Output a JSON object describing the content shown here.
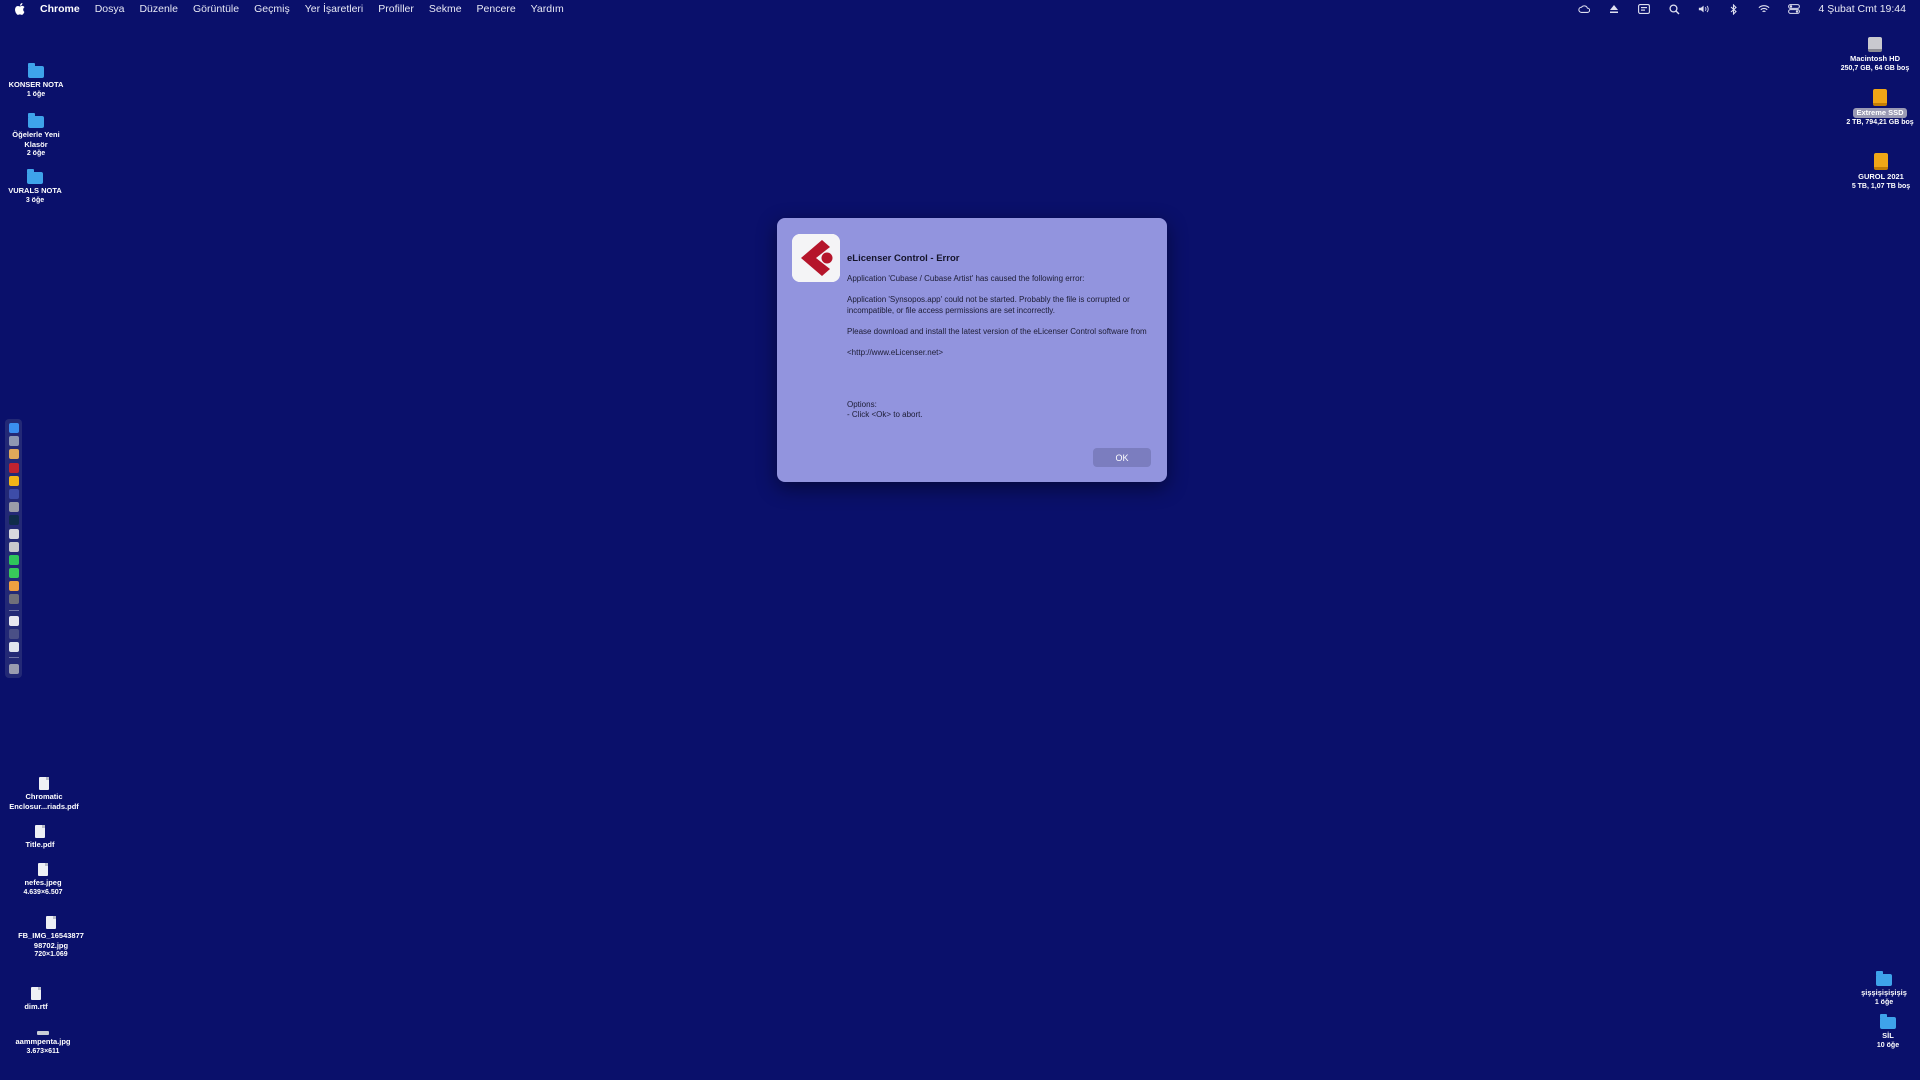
{
  "menubar": {
    "app_name": "Chrome",
    "items": [
      "Dosya",
      "Düzenle",
      "Görüntüle",
      "Geçmiş",
      "Yer İşaretleri",
      "Profiller",
      "Sekme",
      "Pencere",
      "Yardım"
    ],
    "clock": "4 Şubat Cmt  19:44",
    "status_icons": [
      "creative-cloud-icon",
      "eject-icon",
      "keyboard-input-icon",
      "search-icon",
      "volume-icon",
      "bluetooth-icon",
      "wifi-icon",
      "control-center-icon"
    ]
  },
  "desktop_left": [
    {
      "label": "KONSER NOTA",
      "sub": "1 öğe",
      "icon": "folder-icon"
    },
    {
      "label": "Öğelerle Yeni Klasör",
      "sub": "2 öğe",
      "icon": "folder-icon"
    },
    {
      "label": "VURALS NOTA",
      "sub": "3 öğe",
      "icon": "folder-icon"
    },
    {
      "label": "Chromatic Enclosur...riads.pdf",
      "sub": "",
      "icon": "document-icon"
    },
    {
      "label": "Title.pdf",
      "sub": "",
      "icon": "document-icon"
    },
    {
      "label": "nefes.jpeg",
      "sub": "4.639×6.507",
      "icon": "image-file-icon"
    },
    {
      "label": "FB_IMG_16543877 98702.jpg",
      "sub": "720×1.069",
      "icon": "image-file-icon"
    },
    {
      "label": "dim.rtf",
      "sub": "",
      "icon": "document-icon"
    },
    {
      "label": "aammpenta.jpg",
      "sub": "3.673×611",
      "icon": "image-file-icon"
    }
  ],
  "desktop_right": [
    {
      "label": "Macintosh HD",
      "sub": "250,7 GB, 64 GB boş",
      "icon": "hard-drive-icon"
    },
    {
      "label": "Extreme SSD",
      "sub": "2 TB, 794,21 GB boş",
      "icon": "external-drive-icon"
    },
    {
      "label": "GUROL 2021",
      "sub": "5 TB, 1,07 TB boş",
      "icon": "external-drive-icon"
    },
    {
      "label": "şişşişişişişiş",
      "sub": "1 öğe",
      "icon": "folder-icon"
    },
    {
      "label": "SİL",
      "sub": "10 öğe",
      "icon": "folder-icon"
    }
  ],
  "dock": {
    "apps": [
      {
        "name": "finder-icon",
        "color": "#3a8ef0"
      },
      {
        "name": "launchpad-icon",
        "color": "#8e97b2"
      },
      {
        "name": "safari-icon",
        "color": "#e0a85a"
      },
      {
        "name": "cubase-icon",
        "color": "#c0232f"
      },
      {
        "name": "chrome-icon",
        "color": "#f2b517"
      },
      {
        "name": "app-blue-icon",
        "color": "#3d4ca8"
      },
      {
        "name": "settings-icon",
        "color": "#9a9ca8"
      },
      {
        "name": "photoshop-icon",
        "color": "#0f2c4a"
      },
      {
        "name": "activity-icon",
        "color": "#d8d8de"
      },
      {
        "name": "compass-icon",
        "color": "#c8c8cc"
      },
      {
        "name": "spotify-icon",
        "color": "#2ec65b"
      },
      {
        "name": "whatsapp-icon",
        "color": "#38c85a"
      },
      {
        "name": "notes-icon",
        "color": "#f0a040"
      },
      {
        "name": "app-gray-icon",
        "color": "#70707a"
      }
    ],
    "recent": [
      {
        "name": "document-app-icon",
        "color": "#e8e8f0"
      },
      {
        "name": "window-app-icon",
        "color": "#4a4f86"
      },
      {
        "name": "folder-app-icon",
        "color": "#e0e4ee"
      },
      {
        "name": "trash-icon",
        "color": "#9a9cb0"
      }
    ]
  },
  "dialog": {
    "title": "eLicenser Control - Error",
    "line1": "Application 'Cubase / Cubase Artist' has caused the following error:",
    "line2": "Application 'Synsopos.app' could not be started. Probably the file is corrupted or incompatible, or file access permissions are set incorrectly.",
    "line3": "Please download and install the latest version of the eLicenser Control software from",
    "url": "<http://www.eLicenser.net>",
    "options_label": "Options:",
    "options_text": "- Click <Ok> to abort.",
    "ok_label": "OK"
  }
}
